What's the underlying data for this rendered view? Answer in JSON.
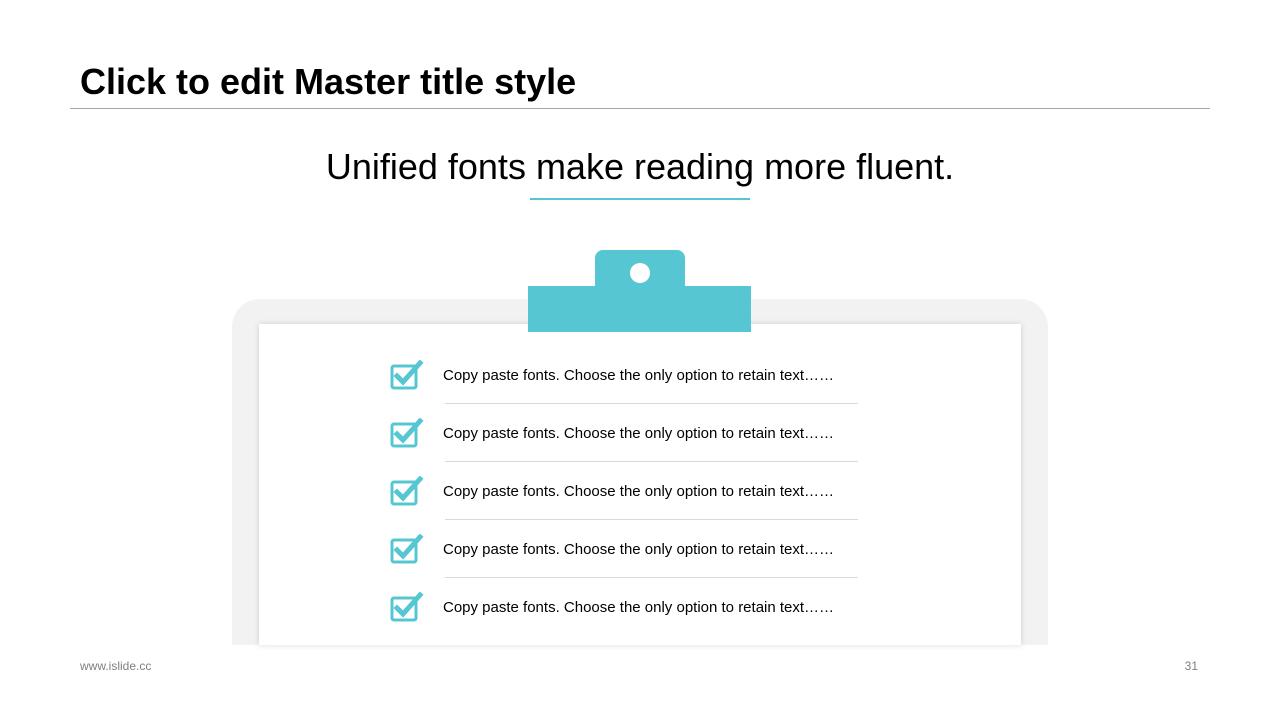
{
  "slide": {
    "title": "Click to edit Master title style",
    "subtitle": "Unified fonts make reading more fluent."
  },
  "checklist": {
    "icon": "checkbox-checked-icon",
    "items": [
      {
        "text": "Copy paste fonts. Choose the only option to retain text……"
      },
      {
        "text": "Copy paste fonts. Choose the only option to retain text……"
      },
      {
        "text": "Copy paste fonts. Choose the only option to retain text……"
      },
      {
        "text": "Copy paste fonts. Choose the only option to retain text……"
      },
      {
        "text": "Copy paste fonts. Choose the only option to retain text……"
      }
    ]
  },
  "footer": {
    "website": "www.islide.cc",
    "page_number": "31"
  },
  "colors": {
    "accent": "#56c7d2",
    "board": "#f2f2f2",
    "rule": "#a6a6a6",
    "footer_text": "#7f7f7f"
  }
}
